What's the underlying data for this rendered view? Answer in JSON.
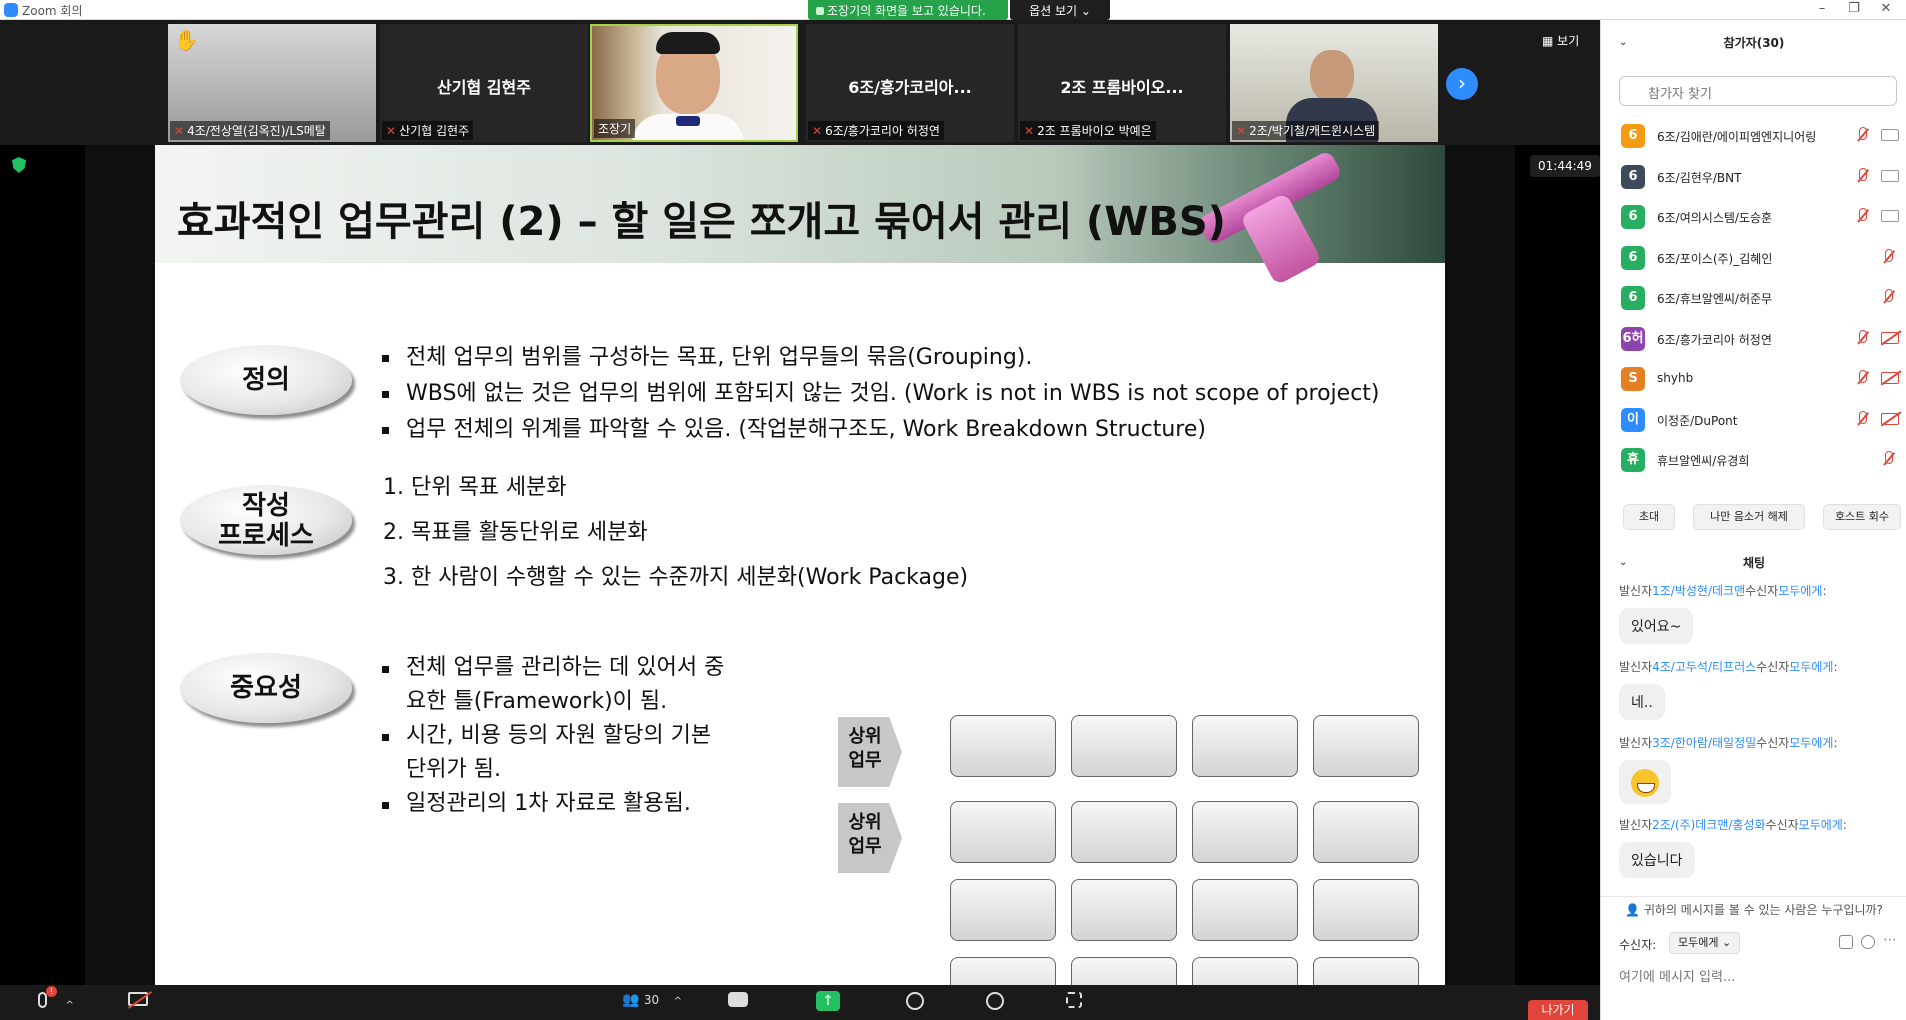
{
  "window": {
    "title": "Zoom 회의",
    "share_banner": "조장기의 화면을 보고 있습니다.",
    "view_options": "옵션 보기 ⌄"
  },
  "video_strip": {
    "tiles": [
      {
        "center_name": "",
        "label": "4조/전상열(김옥진)/LS메탈",
        "raised_hand": true
      },
      {
        "center_name": "산기협 김현주",
        "label": "산기협 김현주"
      },
      {
        "center_name": "",
        "label": "조장기"
      },
      {
        "center_name": "6조/흥가코리아...",
        "label": "6조/흥가코리아 허정연"
      },
      {
        "center_name": "2조 프롬바이오...",
        "label": "2조 프롬바이오 박예은"
      },
      {
        "center_name": "",
        "label": "2조/박기철/캐드윈시스템"
      }
    ],
    "view_button": "보기"
  },
  "meeting": {
    "timer": "01:44:49"
  },
  "slide": {
    "title": "효과적인 업무관리 (2) – 할 일은 쪼개고 묶어서 관리 (WBS)",
    "definition_label": "정의",
    "definition_bullets": [
      "전체 업무의 범위를 구성하는 목표, 단위 업무들의 묶음(Grouping).",
      "WBS에 없는 것은 업무의 범위에 포함되지 않는 것임. (Work is not in WBS is not scope of project)",
      "업무 전체의 위계를 파악할 수 있음. (작업분해구조도, Work Breakdown Structure)"
    ],
    "process_label_line1": "작성",
    "process_label_line2": "프로세스",
    "process_steps": [
      "1. 단위 목표 세분화",
      "2. 목표를 활동단위로 세분화",
      "3. 한 사람이 수행할 수 있는 수준까지 세분화(Work Package)"
    ],
    "importance_label": "중요성",
    "importance_bullets": [
      "전체 업무를 관리하는 데 있어서 중요한 틀(Framework)이 됨.",
      "시간, 비용 등의 자원 할당의 기본 단위가 됨.",
      "일정관리의 1차 자료로 활용됨."
    ],
    "wbs_arrows": [
      {
        "line1": "상위",
        "line2": "업무"
      },
      {
        "line1": "상위",
        "line2": "업무"
      }
    ]
  },
  "toolbar": {
    "participants_count": "30",
    "leave": "나가기",
    "mute_badge": "!"
  },
  "sidebar": {
    "participants_header": "참가자(30)",
    "search_placeholder": "참가자 찾기",
    "participants": [
      {
        "avatar": "6",
        "avatar_color": "#f39c12",
        "name": "6조/김애란/에이피엠엔지니어링",
        "video_off": false
      },
      {
        "avatar": "6",
        "avatar_color": "#3d4a5c",
        "name": "6조/김현우/BNT",
        "video_off": false
      },
      {
        "avatar": "6",
        "avatar_color": "#27ae60",
        "name": "6조/여의시스템/도승훈",
        "video_off": false
      },
      {
        "avatar": "6",
        "avatar_color": "#27ae60",
        "name": "6조/포이스(주)_김혜인",
        "video_off": null
      },
      {
        "avatar": "6",
        "avatar_color": "#27ae60",
        "name": "6조/휴브알엔씨/허준무",
        "video_off": null
      },
      {
        "avatar": "6허",
        "avatar_color": "#8e44ad",
        "name": "6조/흥가코리아 허정연",
        "video_off": true
      },
      {
        "avatar": "S",
        "avatar_color": "#e67e22",
        "name": "shyhb",
        "video_off": true
      },
      {
        "avatar": "이",
        "avatar_color": "#2d8cff",
        "name": "이정준/DuPont",
        "video_off": true
      },
      {
        "avatar": "휴",
        "avatar_color": "#27ae60",
        "name": "휴브알엔씨/유경희",
        "video_off": null
      }
    ],
    "actions": [
      "초대",
      "나만 음소거 해제",
      "호스트 회수"
    ],
    "chat_header": "채팅",
    "chat": [
      {
        "prefix": "발신자",
        "from": "1조/박성현/데크맨",
        "mid": "수신자",
        "to": "모두에게",
        "suffix": ":",
        "text": "있어요~"
      },
      {
        "prefix": "발신자",
        "from": "4조/고두석/티프러스",
        "mid": "수신자",
        "to": "모두에게",
        "suffix": ":",
        "text": "네.."
      },
      {
        "prefix": "발신자",
        "from": "3조/한아람/태일정밀",
        "mid": "수신자",
        "to": "모두에게",
        "suffix": ":",
        "emoji": "grinning-face"
      },
      {
        "prefix": "발신자",
        "from": "2조/(주)데크맨/홍성화",
        "mid": "수신자",
        "to": "모두에게",
        "suffix": ":",
        "text": "있습니다"
      }
    ],
    "who_can_see": "귀하의 메시지를 볼 수 있는 사람은 누구입니까?",
    "recipient_label": "수신자:",
    "recipient_value": "모두에게 ⌄",
    "input_placeholder": "여기에 메시지 입력..."
  }
}
